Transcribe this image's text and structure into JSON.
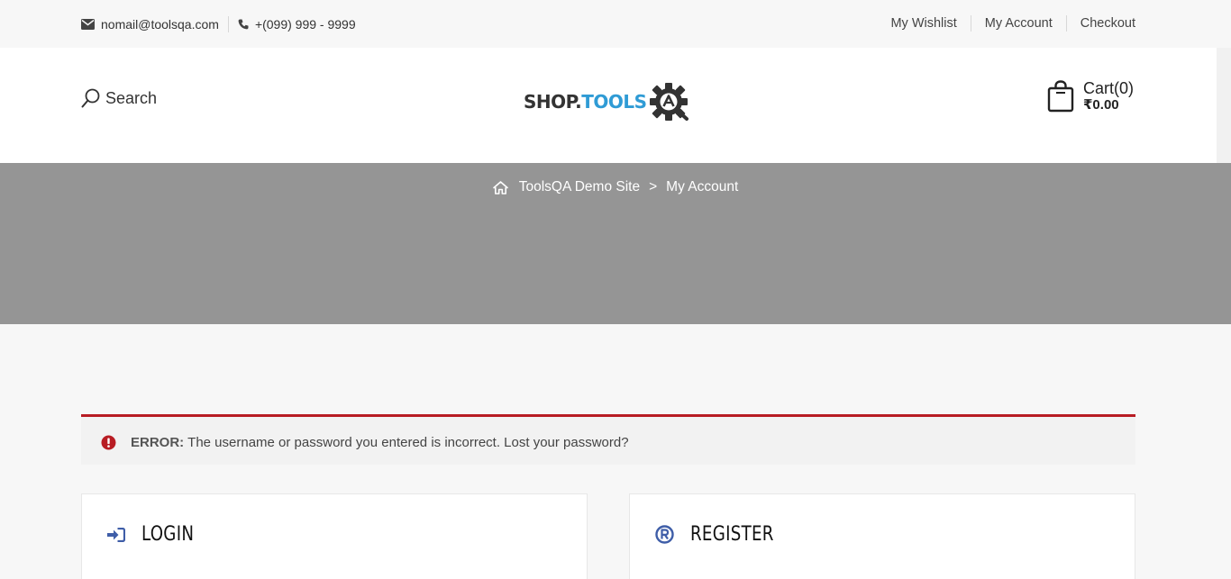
{
  "topbar": {
    "email": "nomail@toolsqa.com",
    "phone": "+(099) 999 - 9999",
    "links": [
      "My Wishlist",
      "My Account",
      "Checkout"
    ]
  },
  "header": {
    "search_label": "Search",
    "logo": {
      "part1": "SHOP.",
      "part2": "TOOLS",
      "badge_letter": "A"
    },
    "cart": {
      "title": "Cart(0)",
      "amount": "₹0.00"
    }
  },
  "breadcrumb": {
    "home": "ToolsQA Demo Site",
    "separator": ">",
    "current": "My Account"
  },
  "error": {
    "label": "ERROR:",
    "message": "The username or password you entered is incorrect. Lost your password?"
  },
  "panels": {
    "login_title": "LOGIN",
    "register_title": "REGISTER"
  },
  "colors": {
    "accent_blue": "#2f9bd5",
    "error_red": "#b81c23",
    "icon_blue": "#3f5ea8",
    "banner_gray": "#959595"
  },
  "icons": [
    "envelope-icon",
    "phone-icon",
    "search-icon",
    "cart-bag-icon",
    "home-icon",
    "error-icon",
    "sign-in-icon",
    "registered-icon",
    "logo-gear-icon"
  ]
}
